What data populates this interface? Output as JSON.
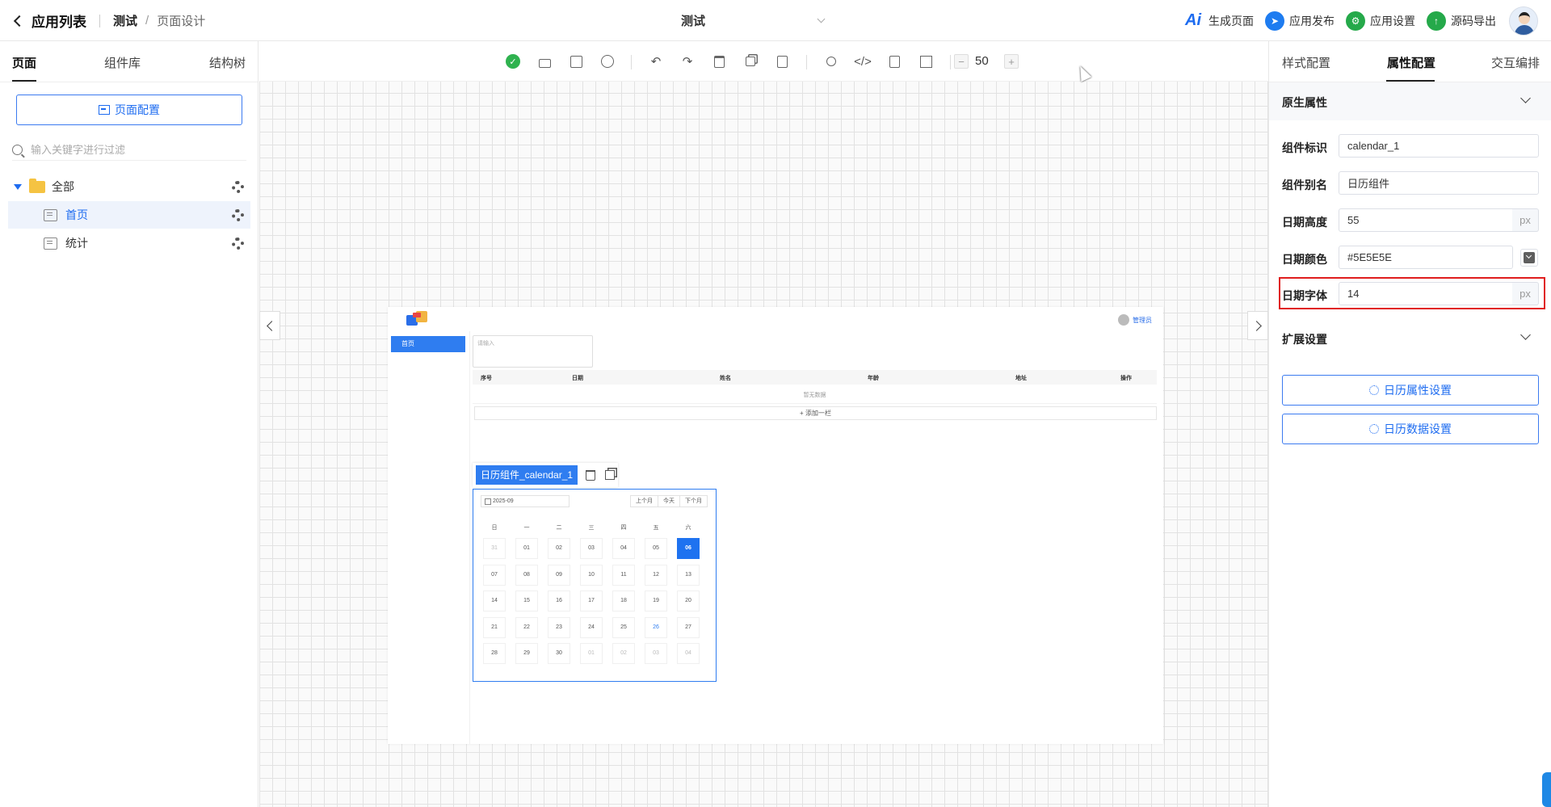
{
  "header": {
    "app_list": "应用列表",
    "crumb_app": "测试",
    "crumb_sep": "/",
    "crumb_page": "页面设计",
    "center_app": "测试",
    "actions": {
      "ai_icon_text": "Ai",
      "generate": "生成页面",
      "publish": "应用发布",
      "settings": "应用设置",
      "export": "源码导出"
    }
  },
  "left": {
    "tabs": [
      "页面",
      "组件库",
      "结构树"
    ],
    "page_config": "页面配置",
    "search_placeholder": "输入关键字进行过滤",
    "tree": {
      "root": "全部",
      "items": [
        "首页",
        "统计"
      ]
    }
  },
  "toolbar": {
    "zoom": "50",
    "zoom_minus": "−",
    "zoom_plus": "+",
    "ok_mark": "✓"
  },
  "preview": {
    "user": "管理员",
    "nav_item": "首页",
    "textarea_placeholder": "请输入",
    "table_headers": [
      "序号",
      "日期",
      "姓名",
      "年龄",
      "地址",
      "操作"
    ],
    "empty_text": "暂无数据",
    "add_row": "+ 添加一栏",
    "calendar": {
      "tag": "日历组件_calendar_1",
      "month": "2025-09",
      "btn_prev": "上个月",
      "btn_today": "今天",
      "btn_next": "下个月",
      "weekdays": [
        "日",
        "一",
        "二",
        "三",
        "四",
        "五",
        "六"
      ],
      "weeks": [
        [
          "31",
          "01",
          "02",
          "03",
          "04",
          "05",
          "06"
        ],
        [
          "07",
          "08",
          "09",
          "10",
          "11",
          "12",
          "13"
        ],
        [
          "14",
          "15",
          "16",
          "17",
          "18",
          "19",
          "20"
        ],
        [
          "21",
          "22",
          "23",
          "24",
          "25",
          "26",
          "27"
        ],
        [
          "28",
          "29",
          "30",
          "01",
          "02",
          "03",
          "04"
        ]
      ],
      "selected": "06",
      "today": "26"
    }
  },
  "right": {
    "tabs": [
      "样式配置",
      "属性配置",
      "交互编排"
    ],
    "section_native": "原生属性",
    "props": [
      {
        "label": "组件标识",
        "value": "calendar_1"
      },
      {
        "label": "组件别名",
        "value": "日历组件"
      },
      {
        "label": "日期高度",
        "value": "55",
        "unit": "px"
      },
      {
        "label": "日期颜色",
        "value": "#5E5E5E"
      },
      {
        "label": "日期字体",
        "value": "14",
        "unit": "px"
      }
    ],
    "section_ext": "扩展设置",
    "ext_buttons": [
      "日历属性设置",
      "日历数据设置"
    ]
  },
  "colors": {
    "accent": "#1e6cf0",
    "date_color": "#5e5e5e",
    "highlight": "#e01e1e"
  }
}
